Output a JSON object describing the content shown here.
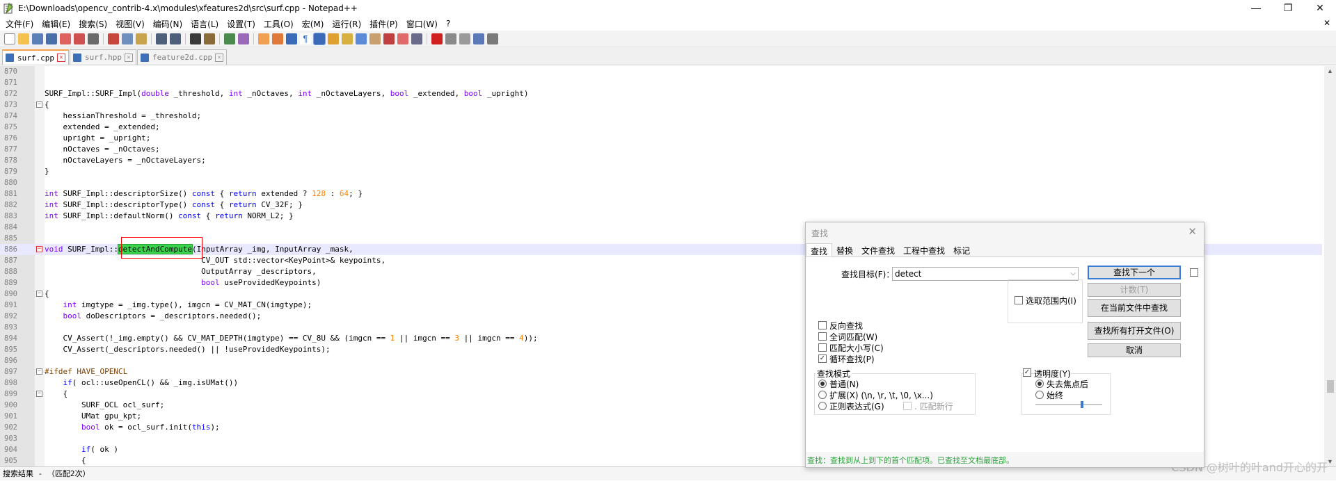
{
  "window": {
    "title": "E:\\Downloads\\opencv_contrib-4.x\\modules\\xfeatures2d\\src\\surf.cpp - Notepad++",
    "minimize": "—",
    "maximize": "❐",
    "close": "✕"
  },
  "menu": {
    "items": [
      "文件(F)",
      "编辑(E)",
      "搜索(S)",
      "视图(V)",
      "编码(N)",
      "语言(L)",
      "设置(T)",
      "工具(O)",
      "宏(M)",
      "运行(R)",
      "插件(P)",
      "窗口(W)",
      "?"
    ],
    "close": "✕"
  },
  "tabs": [
    {
      "label": "surf.cpp",
      "active": true
    },
    {
      "label": "surf.hpp",
      "active": false
    },
    {
      "label": "feature2d.cpp",
      "active": false
    }
  ],
  "editor": {
    "lines": [
      {
        "n": "870",
        "code": ""
      },
      {
        "n": "871",
        "code": ""
      },
      {
        "n": "872",
        "code": "SURF_Impl::SURF_Impl(double _threshold, int _nOctaves, int _nOctaveLayers, bool _extended, bool _upright)"
      },
      {
        "n": "873",
        "code": "{"
      },
      {
        "n": "874",
        "code": "    hessianThreshold = _threshold;"
      },
      {
        "n": "875",
        "code": "    extended = _extended;"
      },
      {
        "n": "876",
        "code": "    upright = _upright;"
      },
      {
        "n": "877",
        "code": "    nOctaves = _nOctaves;"
      },
      {
        "n": "878",
        "code": "    nOctaveLayers = _nOctaveLayers;"
      },
      {
        "n": "879",
        "code": "}"
      },
      {
        "n": "880",
        "code": ""
      },
      {
        "n": "881",
        "code": "int SURF_Impl::descriptorSize() const { return extended ? 128 : 64; }"
      },
      {
        "n": "882",
        "code": "int SURF_Impl::descriptorType() const { return CV_32F; }"
      },
      {
        "n": "883",
        "code": "int SURF_Impl::defaultNorm() const { return NORM_L2; }"
      },
      {
        "n": "884",
        "code": ""
      },
      {
        "n": "885",
        "code": ""
      },
      {
        "n": "886",
        "code": "void SURF_Impl::detectAndCompute(InputArray _img, InputArray _mask,"
      },
      {
        "n": "887",
        "code": "                                  CV_OUT std::vector<KeyPoint>& keypoints,"
      },
      {
        "n": "888",
        "code": "                                  OutputArray _descriptors,"
      },
      {
        "n": "889",
        "code": "                                  bool useProvidedKeypoints)"
      },
      {
        "n": "890",
        "code": "{"
      },
      {
        "n": "891",
        "code": "    int imgtype = _img.type(), imgcn = CV_MAT_CN(imgtype);"
      },
      {
        "n": "892",
        "code": "    bool doDescriptors = _descriptors.needed();"
      },
      {
        "n": "893",
        "code": ""
      },
      {
        "n": "894",
        "code": "    CV_Assert(!_img.empty() && CV_MAT_DEPTH(imgtype) == CV_8U && (imgcn == 1 || imgcn == 3 || imgcn == 4));"
      },
      {
        "n": "895",
        "code": "    CV_Assert(_descriptors.needed() || !useProvidedKeypoints);"
      },
      {
        "n": "896",
        "code": ""
      },
      {
        "n": "897",
        "code": "#ifdef HAVE_OPENCL"
      },
      {
        "n": "898",
        "code": "    if( ocl::useOpenCL() && _img.isUMat())"
      },
      {
        "n": "899",
        "code": "    {"
      },
      {
        "n": "900",
        "code": "        SURF_OCL ocl_surf;"
      },
      {
        "n": "901",
        "code": "        UMat gpu_kpt;"
      },
      {
        "n": "902",
        "code": "        bool ok = ocl_surf.init(this);"
      },
      {
        "n": "903",
        "code": ""
      },
      {
        "n": "904",
        "code": "        if( ok )"
      },
      {
        "n": "905",
        "code": "        {"
      }
    ]
  },
  "results_bar": {
    "text": "搜索结果 - （匹配2次）"
  },
  "watermark": "CSDN @树叶的叶and开心的开",
  "find_dialog": {
    "title": "查找",
    "close": "✕",
    "tabs": [
      "查找",
      "替换",
      "文件查找",
      "工程中查找",
      "标记"
    ],
    "target_label": "查找目标(F)：",
    "target_value": "detect",
    "buttons": {
      "find_next": "查找下一个",
      "count": "计数(T)",
      "find_in_current": "在当前文件中查找",
      "find_in_all_open": "查找所有打开文件(O)",
      "cancel": "取消"
    },
    "in_selection": "选取范围内(I)",
    "options": [
      {
        "label": "反向查找",
        "checked": false
      },
      {
        "label": "全词匹配(W)",
        "checked": false
      },
      {
        "label": "匹配大小写(C)",
        "checked": false
      },
      {
        "label": "循环查找(P)",
        "checked": true
      }
    ],
    "mode": {
      "title": "查找模式",
      "normal": "普通(N)",
      "extended": "扩展(X) (\\n, \\r, \\t, \\0, \\x...)",
      "regex": "正则表达式(G)",
      "dot_newline": ". 匹配新行"
    },
    "transparency": {
      "title": "透明度(Y)",
      "checked": true,
      "on_lose_focus": "失去焦点后",
      "always": "始终",
      "level": 0.7
    },
    "status": "查找：查找到从上到下的首个匹配项。已查找至文档最底部。"
  }
}
